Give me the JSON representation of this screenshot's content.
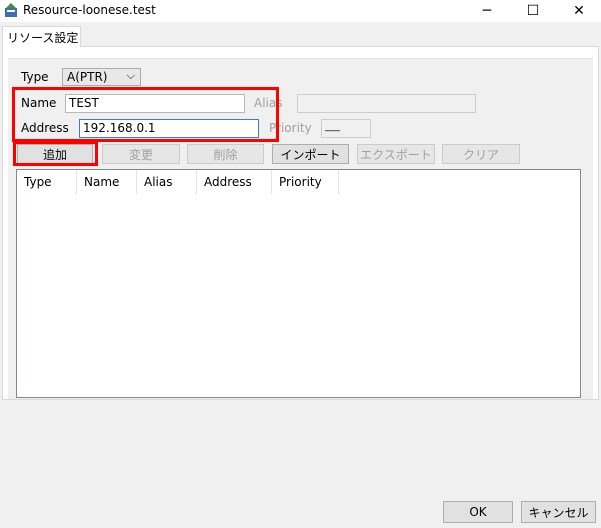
{
  "window": {
    "title": "Resource-loonese.test",
    "minimize_glyph": "─",
    "maximize_glyph": "☐",
    "close_glyph": "✕"
  },
  "tab": {
    "label": "リソース設定"
  },
  "form": {
    "type_label": "Type",
    "type_value": "A(PTR)",
    "name_label": "Name",
    "name_value": "TEST",
    "alias_label": "Alias",
    "alias_value": "",
    "address_label": "Address",
    "address_value": "192.168.0.1",
    "priority_label": "Priority",
    "priority_value": "___"
  },
  "actions": {
    "add": "追加",
    "change": "変更",
    "delete": "削除",
    "import": "インポート",
    "export": "エクスポート",
    "clear": "クリア"
  },
  "list": {
    "columns": [
      "Type",
      "Name",
      "Alias",
      "Address",
      "Priority"
    ],
    "rows": []
  },
  "footer": {
    "ok": "OK",
    "cancel": "キャンセル"
  },
  "colors": {
    "highlight": "#ff0000",
    "field_focus": "#3d7ecb"
  }
}
